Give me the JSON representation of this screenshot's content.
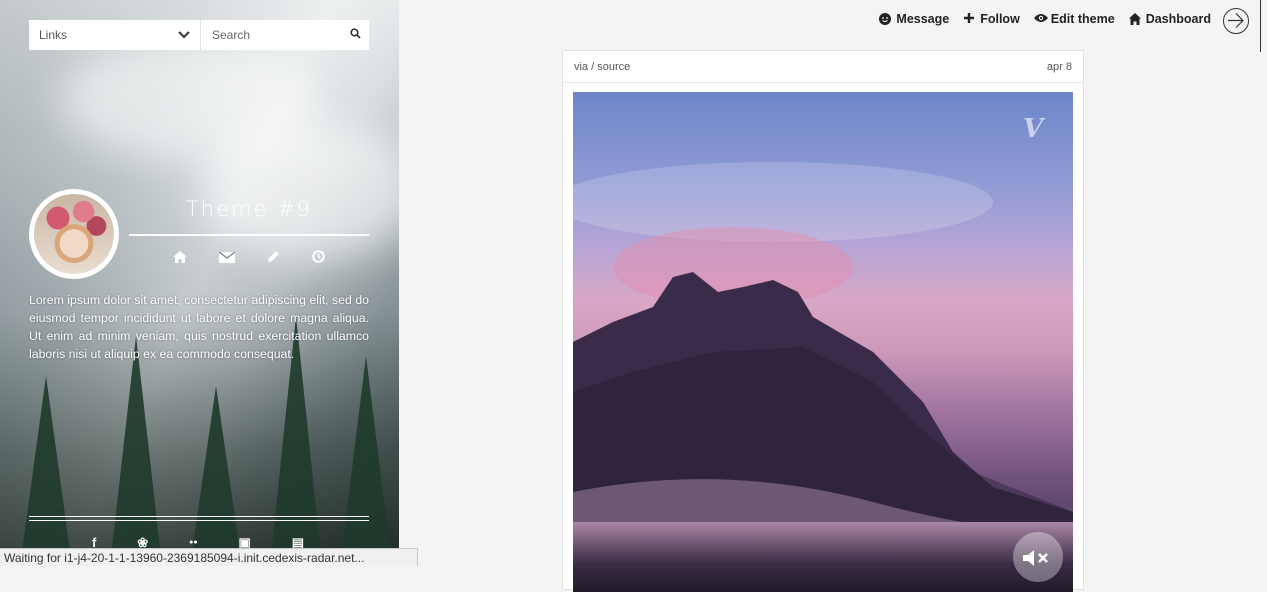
{
  "sidebar": {
    "links_label": "Links",
    "search_placeholder": "Search",
    "blog_title": "Theme #9",
    "description": "Lorem ipsum dolor sit amet, consectetur adipiscing elit, sed do eiusmod tempor incididunt ut labore et dolore magna aliqua. Ut enim ad minim veniam, quis nostrud exercitation ullamco laboris nisi ut aliquip ex ea commodo consequat.",
    "nav_icons": [
      "home-icon",
      "mail-icon",
      "pencil-icon",
      "clock-icon"
    ],
    "social_icons": [
      {
        "name": "facebook-icon",
        "glyph": "f"
      },
      {
        "name": "twitter-icon",
        "glyph": "❀"
      },
      {
        "name": "flickr-icon",
        "glyph": "●●"
      },
      {
        "name": "instagram-icon",
        "glyph": "▣"
      },
      {
        "name": "lastfm-icon",
        "glyph": "▤"
      }
    ]
  },
  "controls": {
    "message": "Message",
    "follow": "Follow",
    "edit_theme": "Edit theme",
    "dashboard": "Dashboard"
  },
  "post": {
    "via": "via / source",
    "date": "apr 8"
  },
  "status_bar": "Waiting for i1-j4-20-1-1-13960-2369185094-i.init.cedexis-radar.net..."
}
